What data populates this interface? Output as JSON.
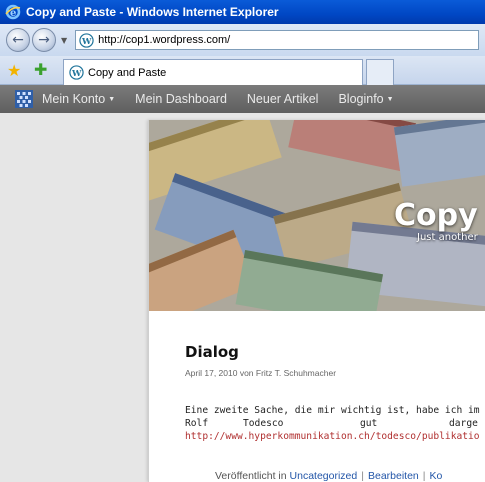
{
  "window": {
    "title": "Copy and Paste - Windows Internet Explorer"
  },
  "address_bar": {
    "url": "http://cop1.wordpress.com/"
  },
  "tabs": [
    {
      "label": "Copy and Paste"
    }
  ],
  "admin_bar": {
    "items": [
      {
        "label": "Mein Konto",
        "has_menu": true
      },
      {
        "label": "Mein Dashboard",
        "has_menu": false
      },
      {
        "label": "Neuer Artikel",
        "has_menu": false
      },
      {
        "label": "Bloginfo",
        "has_menu": true
      }
    ]
  },
  "site": {
    "title": "Copy",
    "description": "Just another"
  },
  "post": {
    "title": "Dialog",
    "meta": "April 17, 2010 von Fritz T. Schuhmacher",
    "line1": "Eine zweite Sache, die mir wichtig ist, habe ich im Bu",
    "line2_words": [
      "Rolf",
      "Todesco",
      "gut",
      "darge"
    ],
    "link": "http://www.hyperkommunikation.ch/todesco/publikatio",
    "footer_prefix": "Veröffentlicht in",
    "footer_category": "Uncategorized",
    "footer_edit": "Bearbeiten",
    "footer_comments": "Ko"
  },
  "colors": {
    "titlebar": "#0047c4",
    "admin_bar": "#6a6a6a",
    "link": "#b03030",
    "footer_link": "#2356a8"
  },
  "icons": {
    "browser": "ie-logo-icon",
    "site": "wordpress-icon",
    "favorites": "favorites-star-icon",
    "add_favorites": "add-favorites-icon"
  }
}
